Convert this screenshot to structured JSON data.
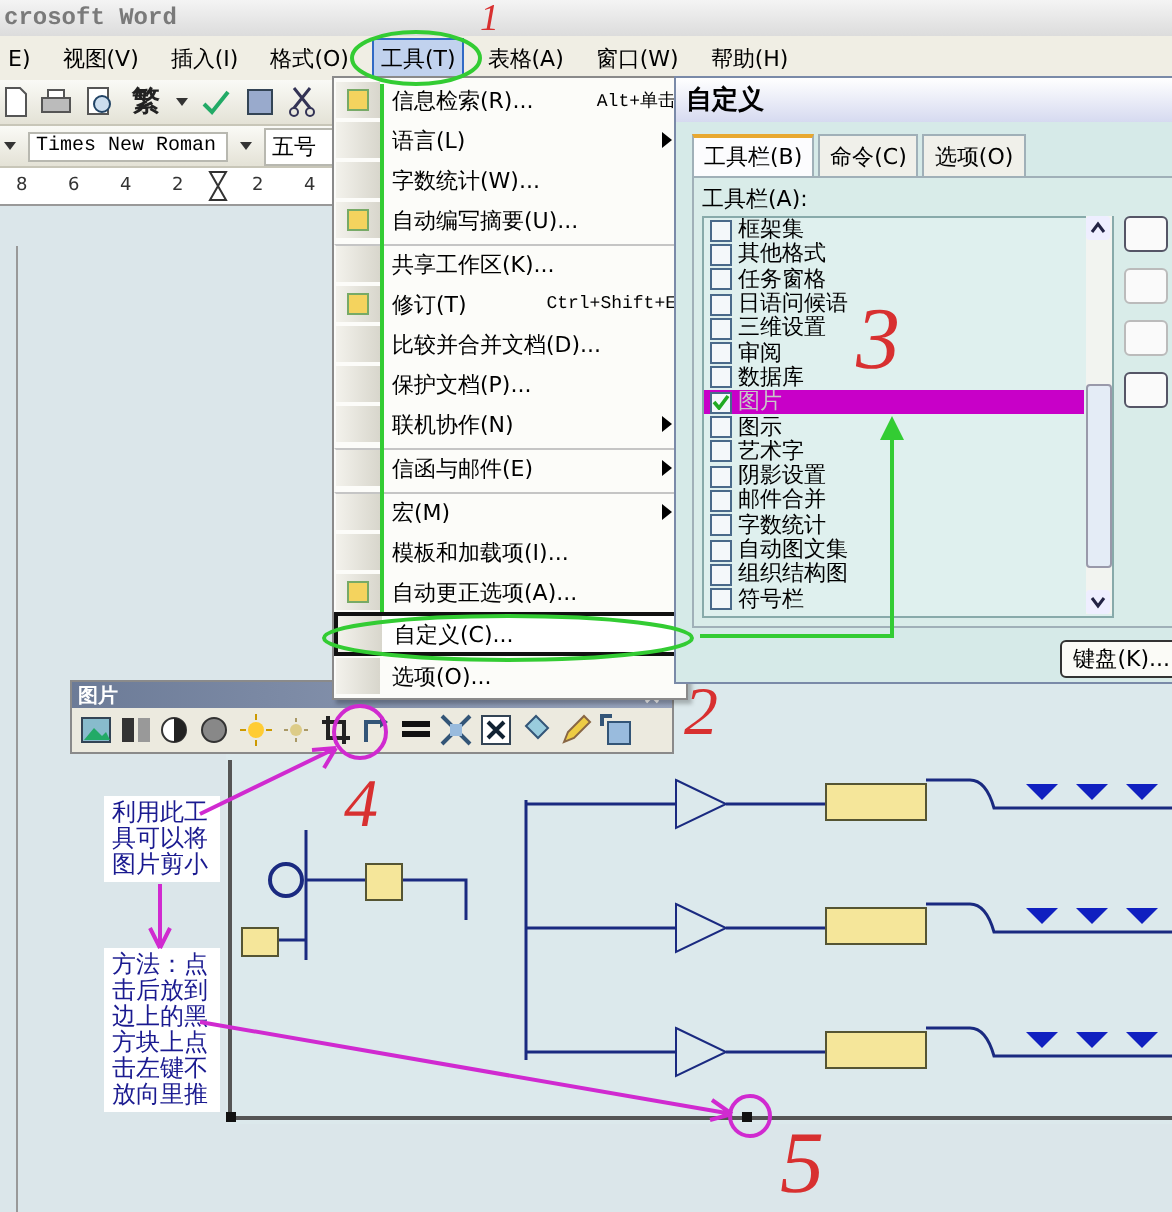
{
  "window": {
    "title": "crosoft Word"
  },
  "menu_bar": [
    {
      "label": "E)",
      "selected": false
    },
    {
      "label": "视图(V)",
      "selected": false
    },
    {
      "label": "插入(I)",
      "selected": false
    },
    {
      "label": "格式(O)",
      "selected": false
    },
    {
      "label": "工具(T)",
      "selected": true
    },
    {
      "label": "表格(A)",
      "selected": false
    },
    {
      "label": "窗口(W)",
      "selected": false
    },
    {
      "label": "帮助(H)",
      "selected": false
    }
  ],
  "standard_toolbar": {
    "traditional_button": "繁"
  },
  "formatting_toolbar": {
    "font": "Times New Roman",
    "size": "五号"
  },
  "ruler": {
    "marks": [
      "8",
      "6",
      "4",
      "2",
      "2",
      "4"
    ]
  },
  "tools_menu": [
    {
      "label": "信息检索(R)...",
      "shortcut": "Alt+单击",
      "submenu": false,
      "has_icon": true,
      "separator_before": false,
      "selected": false
    },
    {
      "label": "语言(L)",
      "submenu": true,
      "has_icon": false,
      "separator_before": false,
      "selected": false
    },
    {
      "label": "字数统计(W)...",
      "submenu": false,
      "has_icon": false,
      "separator_before": false,
      "selected": false
    },
    {
      "label": "自动编写摘要(U)...",
      "submenu": false,
      "has_icon": true,
      "separator_before": false,
      "selected": false
    },
    {
      "label": "共享工作区(K)...",
      "submenu": false,
      "has_icon": false,
      "separator_before": true,
      "selected": false
    },
    {
      "label": "修订(T)",
      "shortcut": "Ctrl+Shift+E",
      "submenu": false,
      "has_icon": true,
      "separator_before": false,
      "selected": false
    },
    {
      "label": "比较并合并文档(D)...",
      "submenu": false,
      "has_icon": false,
      "separator_before": false,
      "selected": false
    },
    {
      "label": "保护文档(P)...",
      "submenu": false,
      "has_icon": false,
      "separator_before": false,
      "selected": false
    },
    {
      "label": "联机协作(N)",
      "submenu": true,
      "has_icon": false,
      "separator_before": false,
      "selected": false
    },
    {
      "label": "信函与邮件(E)",
      "submenu": true,
      "has_icon": false,
      "separator_before": true,
      "selected": false
    },
    {
      "label": "宏(M)",
      "submenu": true,
      "has_icon": false,
      "separator_before": true,
      "selected": false
    },
    {
      "label": "模板和加载项(I)...",
      "submenu": false,
      "has_icon": false,
      "separator_before": false,
      "selected": false
    },
    {
      "label": "自动更正选项(A)...",
      "submenu": false,
      "has_icon": true,
      "separator_before": false,
      "selected": false
    },
    {
      "label": "自定义(C)...",
      "submenu": false,
      "has_icon": false,
      "separator_before": false,
      "selected": true
    },
    {
      "label": "选项(O)...",
      "submenu": false,
      "has_icon": false,
      "separator_before": false,
      "selected": false
    }
  ],
  "customize_dialog": {
    "title": "自定义",
    "tabs": [
      {
        "label": "工具栏(B)",
        "selected": true
      },
      {
        "label": "命令(C)",
        "selected": false
      },
      {
        "label": "选项(O)",
        "selected": false
      }
    ],
    "list_label": "工具栏(A):",
    "toolbars": [
      {
        "label": "框架集",
        "checked": false,
        "selected": false
      },
      {
        "label": "其他格式",
        "checked": false,
        "selected": false
      },
      {
        "label": "任务窗格",
        "checked": false,
        "selected": false
      },
      {
        "label": "日语问候语",
        "checked": false,
        "selected": false
      },
      {
        "label": "三维设置",
        "checked": false,
        "selected": false
      },
      {
        "label": "审阅",
        "checked": false,
        "selected": false
      },
      {
        "label": "数据库",
        "checked": false,
        "selected": false
      },
      {
        "label": "图片",
        "checked": true,
        "selected": true
      },
      {
        "label": "图示",
        "checked": false,
        "selected": false
      },
      {
        "label": "艺术字",
        "checked": false,
        "selected": false
      },
      {
        "label": "阴影设置",
        "checked": false,
        "selected": false
      },
      {
        "label": "邮件合并",
        "checked": false,
        "selected": false
      },
      {
        "label": "字数统计",
        "checked": false,
        "selected": false
      },
      {
        "label": "自动图文集",
        "checked": false,
        "selected": false
      },
      {
        "label": "组织结构图",
        "checked": false,
        "selected": false
      },
      {
        "label": "符号栏",
        "checked": false,
        "selected": false
      }
    ],
    "keyboard_button": "键盘(K)..."
  },
  "picture_toolbar": {
    "title": "图片"
  },
  "notes": [
    "利用此工具可以将图片剪小",
    "方法：点击后放到边上的黑方块上点击左键不放向里推"
  ],
  "step_numbers": [
    "1",
    "2",
    "3",
    "4",
    "5"
  ]
}
